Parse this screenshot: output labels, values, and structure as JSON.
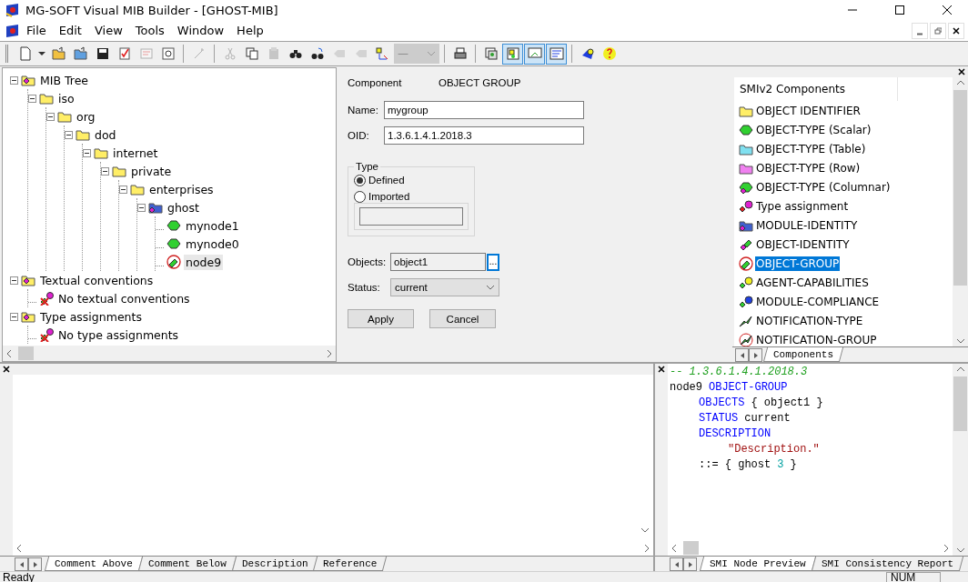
{
  "window": {
    "title": "MG-SOFT Visual MIB Builder - [GHOST-MIB]"
  },
  "menu": [
    "File",
    "Edit",
    "View",
    "Tools",
    "Window",
    "Help"
  ],
  "toolbar": [
    {
      "kind": "button",
      "disabled": false,
      "pressed": false
    },
    {
      "kind": "dropdown",
      "disabled": false
    },
    {
      "kind": "button",
      "disabled": false,
      "pressed": false
    },
    {
      "kind": "button",
      "disabled": false,
      "pressed": false
    },
    {
      "kind": "button",
      "disabled": false,
      "pressed": false
    },
    {
      "kind": "button",
      "disabled": false,
      "pressed": false
    },
    {
      "kind": "button",
      "disabled": true,
      "pressed": false
    },
    {
      "kind": "button",
      "disabled": false,
      "pressed": false
    },
    {
      "kind": "separator"
    },
    {
      "kind": "button",
      "disabled": true,
      "pressed": false
    },
    {
      "kind": "separator"
    },
    {
      "kind": "button",
      "disabled": true,
      "pressed": false
    },
    {
      "kind": "button",
      "disabled": false,
      "pressed": false
    },
    {
      "kind": "button",
      "disabled": true,
      "pressed": false
    },
    {
      "kind": "button",
      "disabled": false,
      "pressed": false
    },
    {
      "kind": "button",
      "disabled": false,
      "pressed": false
    },
    {
      "kind": "button",
      "disabled": true,
      "pressed": false
    },
    {
      "kind": "button",
      "disabled": true,
      "pressed": false
    },
    {
      "kind": "button",
      "disabled": false,
      "pressed": false
    },
    {
      "kind": "combo",
      "value": "—",
      "disabled": true
    },
    {
      "kind": "separator"
    },
    {
      "kind": "button",
      "disabled": false,
      "pressed": false
    },
    {
      "kind": "separator"
    },
    {
      "kind": "button",
      "disabled": false,
      "pressed": false
    },
    {
      "kind": "button",
      "disabled": false,
      "pressed": true
    },
    {
      "kind": "button",
      "disabled": false,
      "pressed": true
    },
    {
      "kind": "button",
      "disabled": false,
      "pressed": true
    },
    {
      "kind": "separator"
    },
    {
      "kind": "button",
      "disabled": false,
      "pressed": false
    },
    {
      "kind": "button",
      "disabled": false,
      "pressed": false
    }
  ],
  "tree": [
    {
      "label": "MIB Tree",
      "kind": "root",
      "expanded": true,
      "selected": false,
      "children": [
        {
          "label": "iso",
          "kind": "folder",
          "expanded": true,
          "selected": false,
          "children": [
            {
              "label": "org",
              "kind": "folder",
              "expanded": true,
              "selected": false,
              "children": [
                {
                  "label": "dod",
                  "kind": "folder",
                  "expanded": true,
                  "selected": false,
                  "children": [
                    {
                      "label": "internet",
                      "kind": "folder",
                      "expanded": true,
                      "selected": false,
                      "children": [
                        {
                          "label": "private",
                          "kind": "folder",
                          "expanded": true,
                          "selected": false,
                          "children": [
                            {
                              "label": "enterprises",
                              "kind": "folder",
                              "expanded": true,
                              "selected": false,
                              "children": [
                                {
                                  "label": "ghost",
                                  "kind": "module",
                                  "expanded": true,
                                  "selected": false,
                                  "children": [
                                    {
                                      "label": "mynode1",
                                      "kind": "scalar",
                                      "selected": false
                                    },
                                    {
                                      "label": "mynode0",
                                      "kind": "scalar",
                                      "selected": false
                                    },
                                    {
                                      "label": "node9",
                                      "kind": "group",
                                      "selected": true
                                    }
                                  ]
                                }
                              ]
                            }
                          ]
                        }
                      ]
                    }
                  ]
                }
              ]
            }
          ]
        }
      ]
    },
    {
      "label": "Textual conventions",
      "kind": "root",
      "expanded": true,
      "selected": false,
      "children": [
        {
          "label": "No textual conventions",
          "kind": "none",
          "selected": false
        }
      ]
    },
    {
      "label": "Type assignments",
      "kind": "root",
      "expanded": true,
      "selected": false,
      "children": [
        {
          "label": "No type assignments",
          "kind": "none",
          "selected": false
        }
      ]
    }
  ],
  "form": {
    "component_label": "Component",
    "component_value": "OBJECT GROUP",
    "name": {
      "label": "Name:",
      "value": "mygroup"
    },
    "oid": {
      "label": "OID:",
      "value": "1.3.6.1.4.1.2018.3"
    },
    "type": {
      "title": "Type",
      "options": [
        {
          "label": "Defined",
          "selected": true
        },
        {
          "label": "Imported",
          "selected": false
        }
      ],
      "imported_disabled": true
    },
    "objects": {
      "label": "Objects:",
      "value": "object1",
      "browse": "..."
    },
    "status": {
      "label": "Status:",
      "value": "current"
    },
    "buttons": [
      "Apply",
      "Cancel"
    ]
  },
  "components": {
    "header": "SMIv2 Components",
    "items": [
      {
        "label": "OBJECT IDENTIFIER",
        "kind": "folder",
        "selected": false
      },
      {
        "label": "OBJECT-TYPE (Scalar)",
        "kind": "scalar",
        "selected": false
      },
      {
        "label": "OBJECT-TYPE (Table)",
        "kind": "table",
        "selected": false
      },
      {
        "label": "OBJECT-TYPE (Row)",
        "kind": "row",
        "selected": false
      },
      {
        "label": "OBJECT-TYPE (Columnar)",
        "kind": "columnar",
        "selected": false
      },
      {
        "label": "Type assignment",
        "kind": "type",
        "selected": false
      },
      {
        "label": "MODULE-IDENTITY",
        "kind": "module",
        "selected": false
      },
      {
        "label": "OBJECT-IDENTITY",
        "kind": "identity",
        "selected": false
      },
      {
        "label": "OBJECT-GROUP",
        "kind": "group",
        "selected": true
      },
      {
        "label": "AGENT-CAPABILITIES",
        "kind": "capabilities",
        "selected": false
      },
      {
        "label": "MODULE-COMPLIANCE",
        "kind": "compliance",
        "selected": false
      },
      {
        "label": "NOTIFICATION-TYPE",
        "kind": "notification",
        "selected": false
      },
      {
        "label": "NOTIFICATION-GROUP",
        "kind": "notification-group",
        "selected": false
      }
    ],
    "tabs": [
      {
        "label": "Components",
        "selected": true
      }
    ]
  },
  "editor_tabs": [
    {
      "label": "Comment Above",
      "selected": true
    },
    {
      "label": "Comment Below",
      "selected": false
    },
    {
      "label": "Description",
      "selected": false
    },
    {
      "label": "Reference",
      "selected": false
    }
  ],
  "preview": {
    "lines": [
      {
        "kind": "top",
        "tokens": [
          {
            "text": "-- 1.3.6.1.4.1.2018.3",
            "kind": "comment"
          }
        ]
      },
      {
        "kind": "top",
        "tokens": [
          {
            "text": "node9",
            "kind": "plain"
          },
          {
            "text": "OBJECT-GROUP",
            "kind": "keyword"
          }
        ]
      },
      {
        "kind": "body",
        "tokens": [
          {
            "text": "OBJECTS",
            "kind": "keyword"
          },
          {
            "text": "{ object1 }",
            "kind": "plain"
          }
        ]
      },
      {
        "kind": "body",
        "tokens": [
          {
            "text": "STATUS",
            "kind": "keyword"
          },
          {
            "text": "current",
            "kind": "plain"
          }
        ]
      },
      {
        "kind": "body",
        "tokens": [
          {
            "text": "DESCRIPTION",
            "kind": "keyword"
          }
        ]
      },
      {
        "kind": "value",
        "tokens": [
          {
            "text": "\"Description.\"",
            "kind": "string"
          }
        ]
      },
      {
        "kind": "body",
        "tokens": [
          {
            "text": "::= { ghost",
            "kind": "plain"
          },
          {
            "text": "3",
            "kind": "number"
          },
          {
            "text": "}",
            "kind": "plain"
          }
        ]
      }
    ],
    "tabs": [
      {
        "label": "SMI Node Preview",
        "selected": true
      },
      {
        "label": "SMI Consistency Report",
        "selected": false
      }
    ]
  },
  "status_bar": {
    "message": "Ready",
    "indicators": [
      "NUM"
    ]
  }
}
